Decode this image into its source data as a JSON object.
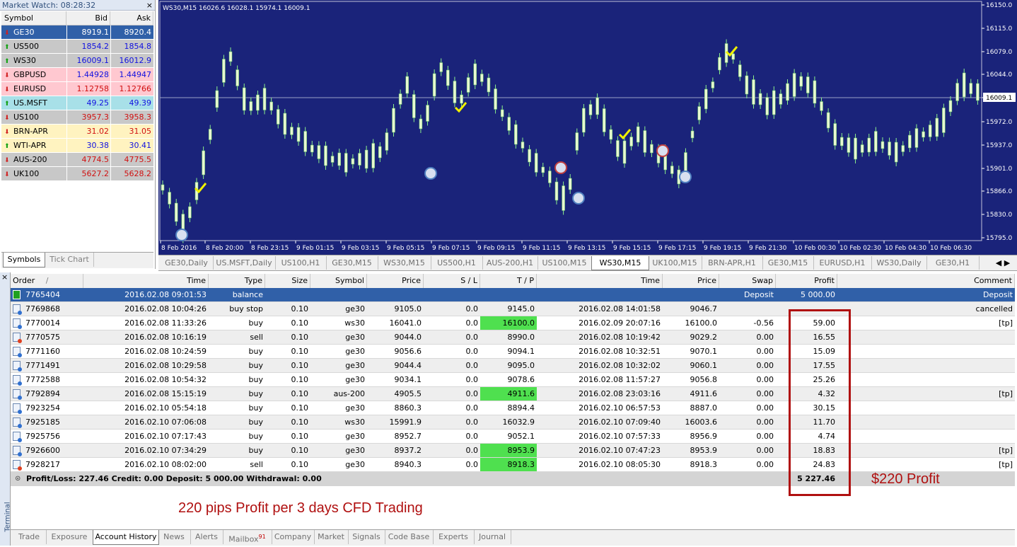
{
  "market_watch": {
    "title": "Market Watch: 08:28:32",
    "close": "×",
    "headers": {
      "symbol": "Symbol",
      "bid": "Bid",
      "ask": "Ask"
    },
    "rows": [
      {
        "symbol": "GE30",
        "bid": "8919.1",
        "ask": "8920.4",
        "dir": "down",
        "bg": "#3060a8",
        "color": "#ffffff"
      },
      {
        "symbol": "US500",
        "bid": "1854.2",
        "ask": "1854.8",
        "dir": "up",
        "bg": "#c8c8c8",
        "color": "#1010e0"
      },
      {
        "symbol": "WS30",
        "bid": "16009.1",
        "ask": "16012.9",
        "dir": "up",
        "bg": "#c8c8c8",
        "color": "#1010e0"
      },
      {
        "symbol": "GBPUSD",
        "bid": "1.44928",
        "ask": "1.44947",
        "dir": "down",
        "bg": "#ffc8d0",
        "color": "#1010e0"
      },
      {
        "symbol": "EURUSD",
        "bid": "1.12758",
        "ask": "1.12766",
        "dir": "down",
        "bg": "#ffc8d0",
        "color": "#d01010"
      },
      {
        "symbol": "US.MSFT",
        "bid": "49.25",
        "ask": "49.39",
        "dir": "up",
        "bg": "#a8e0e8",
        "color": "#1010e0"
      },
      {
        "symbol": "US100",
        "bid": "3957.3",
        "ask": "3958.3",
        "dir": "down",
        "bg": "#c8c8c8",
        "color": "#d01010"
      },
      {
        "symbol": "BRN-APR",
        "bid": "31.02",
        "ask": "31.05",
        "dir": "down",
        "bg": "#fff3c0",
        "color": "#d01010"
      },
      {
        "symbol": "WTI-APR",
        "bid": "30.38",
        "ask": "30.41",
        "dir": "up",
        "bg": "#fff3c0",
        "color": "#1010e0"
      },
      {
        "symbol": "AUS-200",
        "bid": "4774.5",
        "ask": "4775.5",
        "dir": "down",
        "bg": "#c8c8c8",
        "color": "#d01010"
      },
      {
        "symbol": "UK100",
        "bid": "5627.2",
        "ask": "5628.2",
        "dir": "down",
        "bg": "#c8c8c8",
        "color": "#d01010"
      }
    ],
    "tabs": [
      "Symbols",
      "Tick Chart"
    ]
  },
  "chart": {
    "header": "WS30,M15  16026.6 16028.1 15974.1 16009.1",
    "current_price": "16009.1",
    "price_labels": [
      "16150.0",
      "16115.0",
      "16079.0",
      "16044.0",
      "16009.1",
      "15972.0",
      "15937.0",
      "15901.0",
      "15866.0",
      "15830.0",
      "15795.0"
    ],
    "time_labels": [
      "8 Feb 2016",
      "8 Feb 20:00",
      "8 Feb 23:15",
      "9 Feb 01:15",
      "9 Feb 03:15",
      "9 Feb 05:15",
      "9 Feb 07:15",
      "9 Feb 09:15",
      "9 Feb 11:15",
      "9 Feb 13:15",
      "9 Feb 15:15",
      "9 Feb 17:15",
      "9 Feb 19:15",
      "9 Feb 21:30",
      "10 Feb 00:30",
      "10 Feb 02:30",
      "10 Feb 04:30",
      "10 Feb 06:30"
    ],
    "colors": {
      "bg": "#1a237a",
      "bull": "#e8f8d0",
      "bear": "#e8f8d0",
      "wick": "#8cf08c",
      "grid_line": "#9aa0c8",
      "text": "#ffffff",
      "check": "#f0f000"
    },
    "tabs": [
      "GE30,Daily",
      "US.MSFT,Daily",
      "US100,H1",
      "GE30,M15",
      "WS30,M15",
      "US500,H1",
      "AUS-200,H1",
      "US100,M15",
      "WS30,M15",
      "UK100,M15",
      "BRN-APR,H1",
      "GE30,M15",
      "EURUSD,H1",
      "WS30,Daily",
      "GE30,H1"
    ],
    "active_tab": 8
  },
  "terminal": {
    "close": "×",
    "side_label": "Terminal",
    "headers": [
      "Order",
      "Time",
      "Type",
      "Size",
      "Symbol",
      "Price",
      "S / L",
      "T / P",
      "Time",
      "Price",
      "Swap",
      "Profit",
      "Comment"
    ],
    "sort_marker": "/",
    "rows": [
      {
        "order": "7765404",
        "time": "2016.02.08 09:01:53",
        "type": "balance",
        "size": "",
        "symbol": "",
        "price": "",
        "sl": "",
        "tp": "",
        "ctime": "",
        "cprice": "",
        "swap": "Deposit",
        "profit": "5 000.00",
        "comment": "Deposit",
        "tp_hit": false,
        "icon": "balance"
      },
      {
        "order": "7769868",
        "time": "2016.02.08 10:04:26",
        "type": "buy stop",
        "size": "0.10",
        "symbol": "ge30",
        "price": "9105.0",
        "sl": "0.0",
        "tp": "9145.0",
        "ctime": "2016.02.08 14:01:58",
        "cprice": "9046.7",
        "swap": "",
        "profit": "",
        "comment": "cancelled",
        "tp_hit": false,
        "icon": "buy"
      },
      {
        "order": "7770014",
        "time": "2016.02.08 11:33:26",
        "type": "buy",
        "size": "0.10",
        "symbol": "ws30",
        "price": "16041.0",
        "sl": "0.0",
        "tp": "16100.0",
        "ctime": "2016.02.09 20:07:16",
        "cprice": "16100.0",
        "swap": "-0.56",
        "profit": "59.00",
        "comment": "[tp]",
        "tp_hit": true,
        "icon": "buy"
      },
      {
        "order": "7770575",
        "time": "2016.02.08 10:16:19",
        "type": "sell",
        "size": "0.10",
        "symbol": "ge30",
        "price": "9044.0",
        "sl": "0.0",
        "tp": "8990.0",
        "ctime": "2016.02.08 10:19:42",
        "cprice": "9029.2",
        "swap": "0.00",
        "profit": "16.55",
        "comment": "",
        "tp_hit": false,
        "icon": "sell"
      },
      {
        "order": "7771160",
        "time": "2016.02.08 10:24:59",
        "type": "buy",
        "size": "0.10",
        "symbol": "ge30",
        "price": "9056.6",
        "sl": "0.0",
        "tp": "9094.1",
        "ctime": "2016.02.08 10:32:51",
        "cprice": "9070.1",
        "swap": "0.00",
        "profit": "15.09",
        "comment": "",
        "tp_hit": false,
        "icon": "buy"
      },
      {
        "order": "7771491",
        "time": "2016.02.08 10:29:58",
        "type": "buy",
        "size": "0.10",
        "symbol": "ge30",
        "price": "9044.4",
        "sl": "0.0",
        "tp": "9095.0",
        "ctime": "2016.02.08 10:32:02",
        "cprice": "9060.1",
        "swap": "0.00",
        "profit": "17.55",
        "comment": "",
        "tp_hit": false,
        "icon": "buy"
      },
      {
        "order": "7772588",
        "time": "2016.02.08 10:54:32",
        "type": "buy",
        "size": "0.10",
        "symbol": "ge30",
        "price": "9034.1",
        "sl": "0.0",
        "tp": "9078.6",
        "ctime": "2016.02.08 11:57:27",
        "cprice": "9056.8",
        "swap": "0.00",
        "profit": "25.26",
        "comment": "",
        "tp_hit": false,
        "icon": "buy"
      },
      {
        "order": "7792894",
        "time": "2016.02.08 15:15:19",
        "type": "buy",
        "size": "0.10",
        "symbol": "aus-200",
        "price": "4905.5",
        "sl": "0.0",
        "tp": "4911.6",
        "ctime": "2016.02.08 23:03:16",
        "cprice": "4911.6",
        "swap": "0.00",
        "profit": "4.32",
        "comment": "[tp]",
        "tp_hit": true,
        "icon": "buy"
      },
      {
        "order": "7923254",
        "time": "2016.02.10 05:54:18",
        "type": "buy",
        "size": "0.10",
        "symbol": "ge30",
        "price": "8860.3",
        "sl": "0.0",
        "tp": "8894.4",
        "ctime": "2016.02.10 06:57:53",
        "cprice": "8887.0",
        "swap": "0.00",
        "profit": "30.15",
        "comment": "",
        "tp_hit": false,
        "icon": "buy"
      },
      {
        "order": "7925185",
        "time": "2016.02.10 07:06:08",
        "type": "buy",
        "size": "0.10",
        "symbol": "ws30",
        "price": "15991.9",
        "sl": "0.0",
        "tp": "16032.9",
        "ctime": "2016.02.10 07:09:40",
        "cprice": "16003.6",
        "swap": "0.00",
        "profit": "11.70",
        "comment": "",
        "tp_hit": false,
        "icon": "buy"
      },
      {
        "order": "7925756",
        "time": "2016.02.10 07:17:43",
        "type": "buy",
        "size": "0.10",
        "symbol": "ge30",
        "price": "8952.7",
        "sl": "0.0",
        "tp": "9052.1",
        "ctime": "2016.02.10 07:57:33",
        "cprice": "8956.9",
        "swap": "0.00",
        "profit": "4.74",
        "comment": "",
        "tp_hit": false,
        "icon": "buy"
      },
      {
        "order": "7926600",
        "time": "2016.02.10 07:34:29",
        "type": "buy",
        "size": "0.10",
        "symbol": "ge30",
        "price": "8937.2",
        "sl": "0.0",
        "tp": "8953.9",
        "ctime": "2016.02.10 07:47:23",
        "cprice": "8953.9",
        "swap": "0.00",
        "profit": "18.83",
        "comment": "[tp]",
        "tp_hit": true,
        "icon": "buy"
      },
      {
        "order": "7928217",
        "time": "2016.02.10 08:02:00",
        "type": "sell",
        "size": "0.10",
        "symbol": "ge30",
        "price": "8940.3",
        "sl": "0.0",
        "tp": "8918.3",
        "ctime": "2016.02.10 08:05:30",
        "cprice": "8918.3",
        "swap": "0.00",
        "profit": "24.83",
        "comment": "[tp]",
        "tp_hit": true,
        "icon": "sell"
      }
    ],
    "summary_text": "Profit/Loss: 227.46  Credit: 0.00  Deposit: 5 000.00  Withdrawal: 0.00",
    "summary_total": "5 227.46",
    "tabs": [
      "Trade",
      "Exposure",
      "Account History",
      "News",
      "Alerts",
      "Mailbox",
      "Company",
      "Market",
      "Signals",
      "Code Base",
      "Experts",
      "Journal"
    ],
    "mailbox_count": "91",
    "active_tab": 2
  },
  "annotations": {
    "profit_note": "$220 Profit",
    "caption": "220 pips Profit per 3 days CFD Trading"
  }
}
